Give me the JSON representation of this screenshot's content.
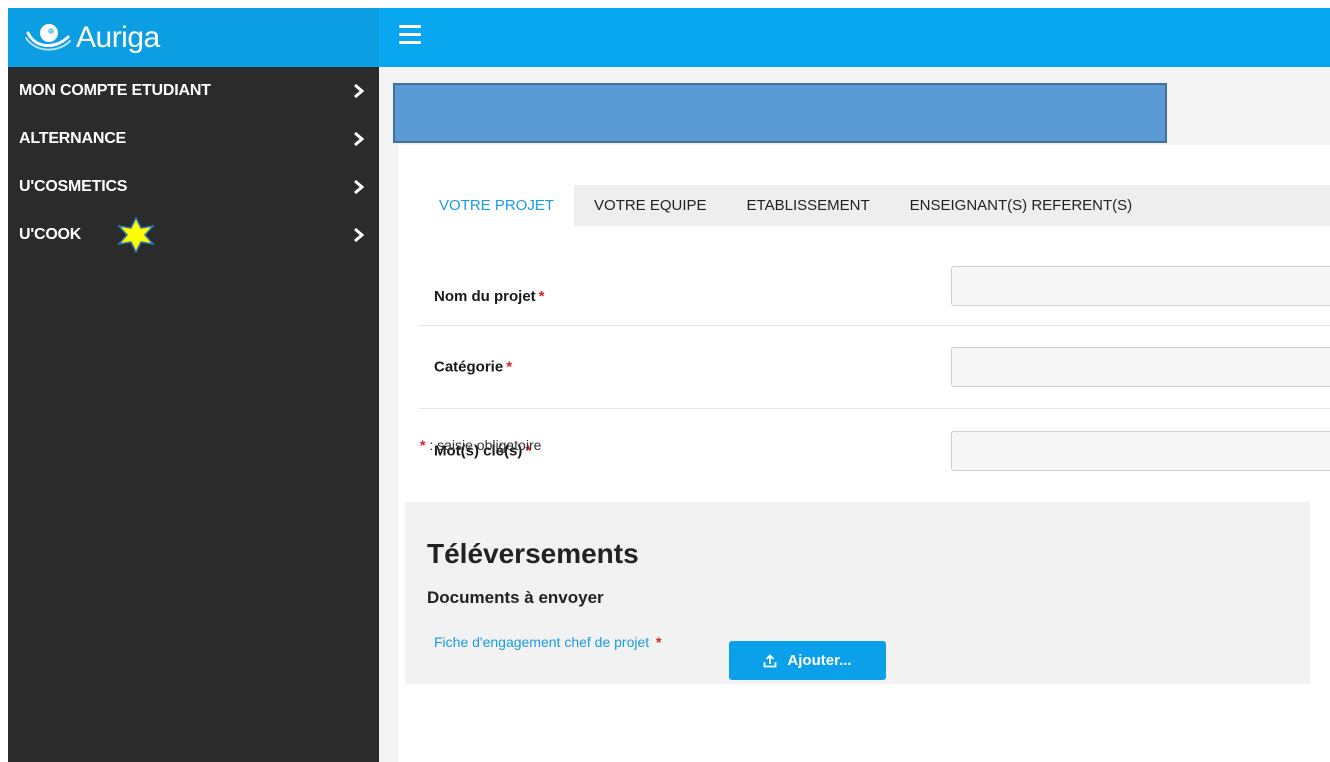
{
  "app": {
    "name": "Auriga"
  },
  "sidebar": {
    "items": [
      {
        "label": "MON COMPTE ETUDIANT"
      },
      {
        "label": "ALTERNANCE"
      },
      {
        "label": "U'COSMETICS"
      },
      {
        "label": "U'COOK"
      }
    ]
  },
  "tabs": [
    {
      "label": "VOTRE PROJET",
      "active": true
    },
    {
      "label": "VOTRE EQUIPE"
    },
    {
      "label": "ETABLISSEMENT"
    },
    {
      "label": "ENSEIGNANT(S) REFERENT(S)"
    }
  ],
  "form": {
    "fields": [
      {
        "label": "Nom du projet",
        "required_mark": "*",
        "value": ""
      },
      {
        "label": "Catégorie",
        "required_mark": "*",
        "value": ""
      },
      {
        "label": "Mot(s) clé(s)",
        "required_mark": "*",
        "value": ""
      }
    ],
    "note_mark": "*",
    "note_text": " : saisie obligatoire"
  },
  "uploads": {
    "title": "Téléversements",
    "subtitle": "Documents à envoyer",
    "document_label": "Fiche d'engagement chef de projet",
    "document_required_mark": "*",
    "add_button_label": "Ajouter..."
  },
  "icons": {
    "logo": "auriga-logo-icon",
    "menu": "hamburger-menu-icon",
    "chevron": "chevron-right-icon",
    "star": "star-icon",
    "upload": "upload-icon"
  },
  "colors": {
    "brand": "#0b9ee3",
    "sidebar": "#2b2b2b",
    "accent": "#1a9ce0",
    "required": "#e31b23",
    "banner": "#5b9bd5",
    "star": "#ffff00"
  }
}
